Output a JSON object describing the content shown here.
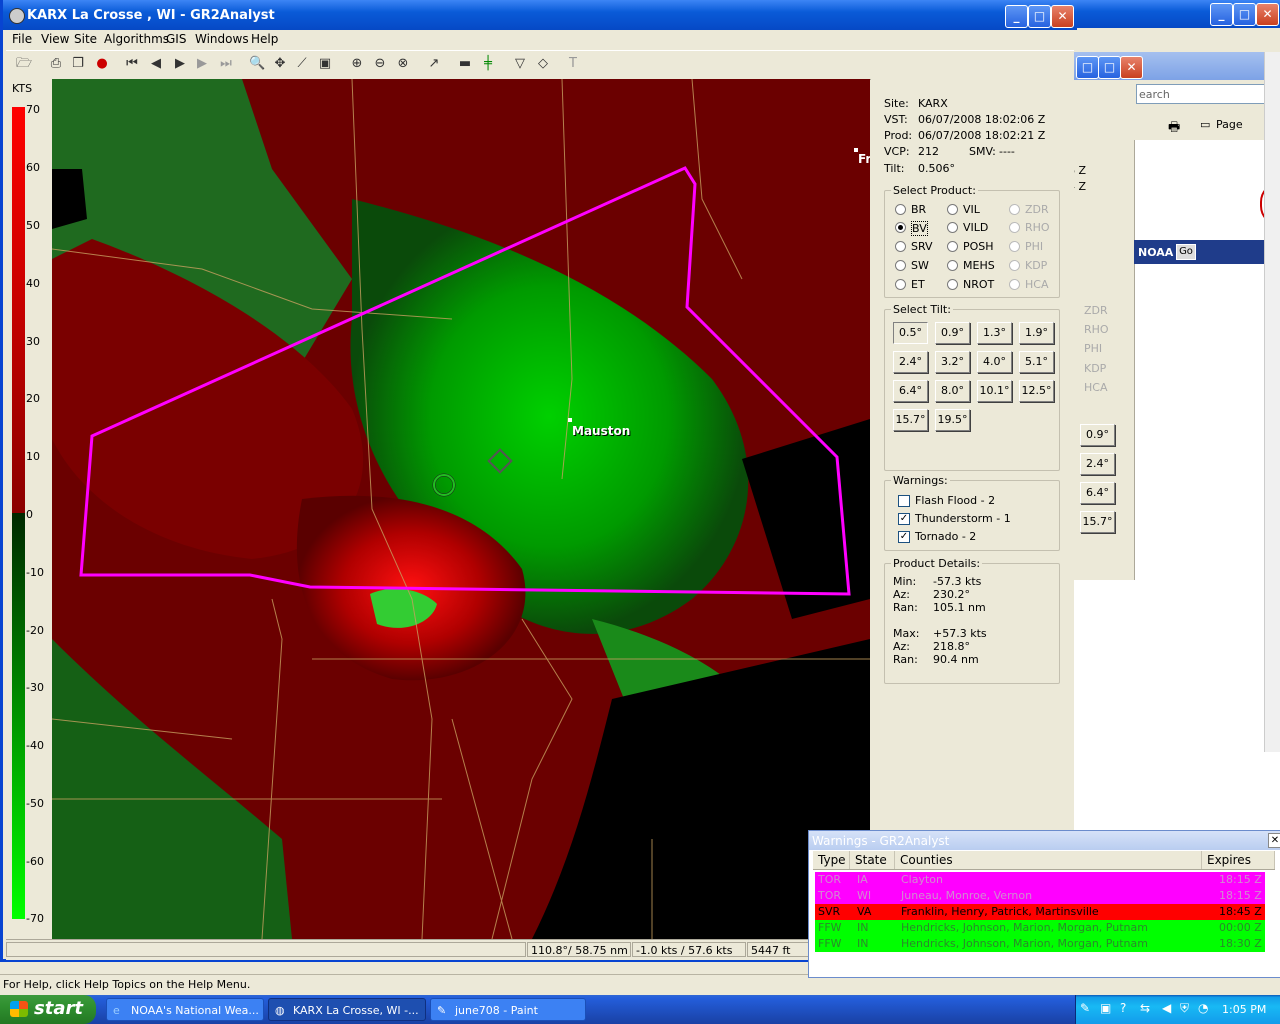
{
  "background_window": {
    "status_text": "For Help, click Help Topics on the Help Menu."
  },
  "ie_window": {
    "search_fragment": "earch",
    "page_label": "Page",
    "noaa_label": "NOAA",
    "go_label": "Go",
    "time_fragments": [
      "6 Z",
      "4 Z"
    ],
    "product_labels": [
      "ZDR",
      "RHO",
      "PHI",
      "KDP",
      "HCA"
    ],
    "tilt_labels": [
      "0.9°",
      "2.4°",
      "6.4°",
      "15.7°"
    ],
    "right_edge_text": "W"
  },
  "main_window": {
    "title": "KARX La Crosse , WI - GR2Analyst",
    "menu": [
      "File",
      "View",
      "Site",
      "Algorithms",
      "GIS",
      "Windows",
      "Help"
    ],
    "scale": {
      "unit": "KTS",
      "ticks": [
        "70",
        "60",
        "50",
        "40",
        "30",
        "20",
        "10",
        "0",
        "-10",
        "-20",
        "-30",
        "-40",
        "-50",
        "-60",
        "-70"
      ]
    },
    "map": {
      "city_label": "Mauston",
      "edge_label": "Fr"
    },
    "info": {
      "site_label": "Site:",
      "site": "KARX",
      "vst_label": "VST:",
      "vst": "06/07/2008  18:02:06 Z",
      "prod_label": "Prod:",
      "prod": "06/07/2008  18:02:21 Z",
      "vcp_label": "VCP:",
      "vcp": "212",
      "smv_label": "SMV:",
      "smv": "----",
      "tilt_label": "Tilt:",
      "tilt": "0.506°"
    },
    "select_product": {
      "title": "Select Product:",
      "col1": [
        "BR",
        "BV",
        "SRV",
        "SW",
        "ET"
      ],
      "col2": [
        "VIL",
        "VILD",
        "POSH",
        "MEHS",
        "NROT"
      ],
      "col3": [
        "ZDR",
        "RHO",
        "PHI",
        "KDP",
        "HCA"
      ],
      "selected": "BV"
    },
    "select_tilt": {
      "title": "Select Tilt:",
      "tilts": [
        "0.5°",
        "0.9°",
        "1.3°",
        "1.9°",
        "2.4°",
        "3.2°",
        "4.0°",
        "5.1°",
        "6.4°",
        "8.0°",
        "10.1°",
        "12.5°",
        "15.7°",
        "19.5°"
      ],
      "selected": "0.5°"
    },
    "warnings": {
      "title": "Warnings:",
      "items": [
        {
          "label": "Flash Flood - 2",
          "checked": false
        },
        {
          "label": "Thunderstorm - 1",
          "checked": true
        },
        {
          "label": "Tornado - 2",
          "checked": true
        }
      ]
    },
    "product_details": {
      "title": "Product Details:",
      "min_label": "Min:",
      "min": "-57.3 kts",
      "az1_label": "Az:",
      "az1": "230.2°",
      "ran1_label": "Ran:",
      "ran1": "105.1 nm",
      "max_label": "Max:",
      "max": "+57.3 kts",
      "az2_label": "Az:",
      "az2": "218.8°",
      "ran2_label": "Ran:",
      "ran2": "90.4 nm"
    },
    "status": {
      "azran": "110.8°/ 58.75 nm",
      "velocity": "-1.0 kts / 57.6 kts",
      "height": "5447 ft"
    }
  },
  "warnings_window": {
    "title": "Warnings - GR2Analyst",
    "columns": [
      "Type",
      "State",
      "Counties",
      "Expires"
    ],
    "rows": [
      {
        "type": "TOR",
        "state": "IA",
        "counties": "Clayton",
        "expires": "18:15 Z",
        "color": "#ff00ff"
      },
      {
        "type": "TOR",
        "state": "WI",
        "counties": "Juneau, Monroe, Vernon",
        "expires": "18:15 Z",
        "color": "#ff00ff"
      },
      {
        "type": "SVR",
        "state": "VA",
        "counties": "Franklin, Henry, Patrick, Martinsville",
        "expires": "18:45 Z",
        "color": "#ff0000"
      },
      {
        "type": "FFW",
        "state": "IN",
        "counties": "Hendricks, Johnson, Marion, Morgan, Putnam",
        "expires": "00:00 Z",
        "color": "#00ff00"
      },
      {
        "type": "FFW",
        "state": "IN",
        "counties": "Hendricks, Johnson, Marion, Morgan, Putnam",
        "expires": "18:30 Z",
        "color": "#00ff00"
      }
    ]
  },
  "taskbar": {
    "start": "start",
    "items": [
      "NOAA's National Wea...",
      "KARX La Crosse, WI -...",
      "june708 - Paint"
    ],
    "clock": "1:05 PM"
  },
  "colors": {
    "warning_polygon": "#ff00ff",
    "xp_blue": "#0a5bd8"
  }
}
